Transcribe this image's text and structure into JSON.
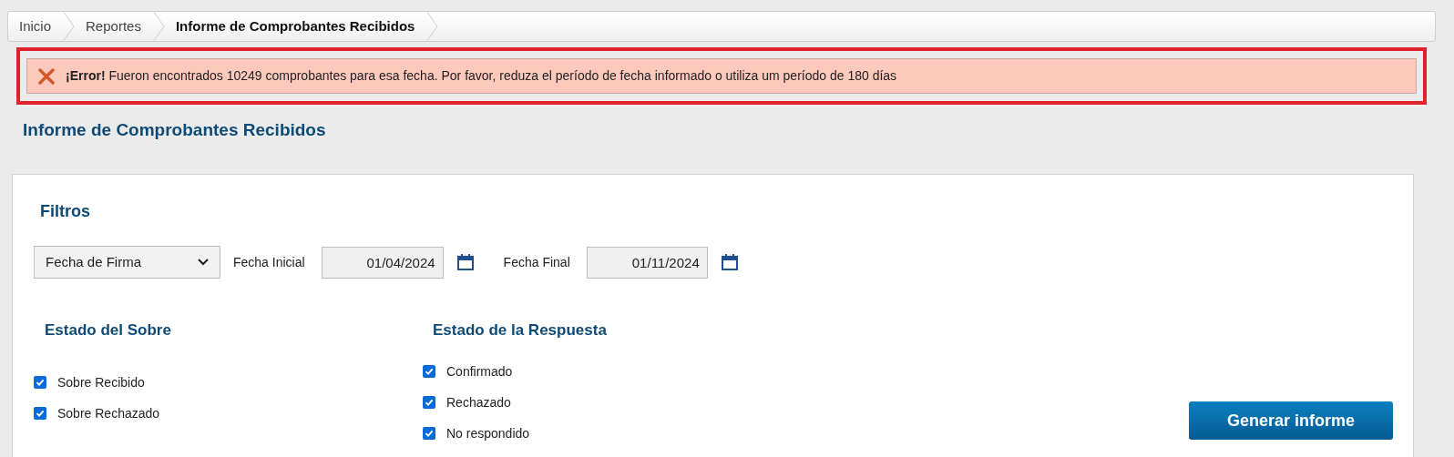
{
  "breadcrumb": [
    {
      "label": "Inicio",
      "selected": false
    },
    {
      "label": "Reportes",
      "selected": false
    },
    {
      "label": "Informe de Comprobantes Recibidos",
      "selected": true
    }
  ],
  "alert": {
    "kind": "error",
    "message": "**¡Error!** Fueron encontrados 10249 comprobantes para esa fecha. Por favor, reduza el período de fecha informado o utiliza um período de 180 días"
  },
  "page_title": "Informe de Comprobantes Recibidos",
  "filters": {
    "title": "Filtros",
    "date_type": "Fecha de Firma",
    "start_label": "Fecha Inicial",
    "start_date": "01/04/2024",
    "end_label": "Fecha Final",
    "end_date": "01/11/2024"
  },
  "envelope_status": {
    "title": "Estado del Sobre",
    "options": [
      {
        "label": "Sobre Recibido",
        "checked": true
      },
      {
        "label": "Sobre Rechazado",
        "checked": true
      }
    ]
  },
  "response_status": {
    "title": "Estado de la Respuesta",
    "options": [
      {
        "label": "Confirmado",
        "checked": true
      },
      {
        "label": "Rechazado",
        "checked": true
      },
      {
        "label": "No respondido",
        "checked": true
      }
    ]
  },
  "generate_button": "Generar informe"
}
